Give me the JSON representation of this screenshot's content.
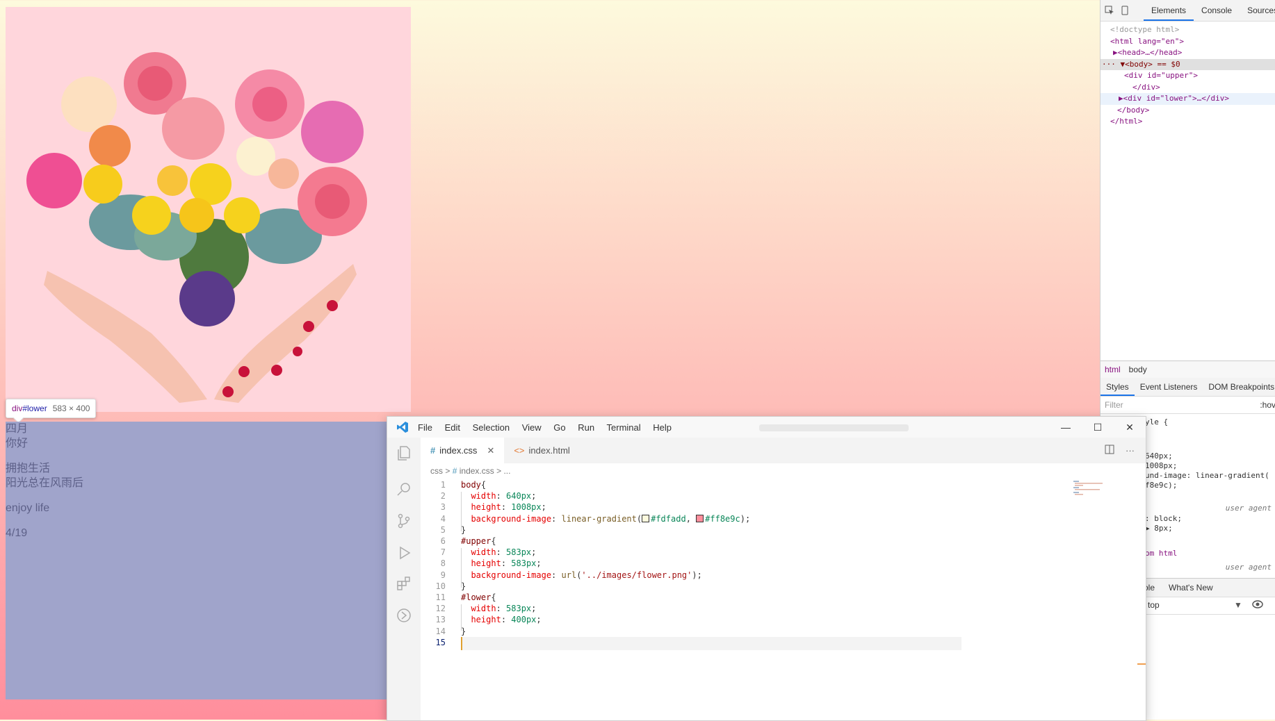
{
  "page": {
    "upper_id": "upper",
    "tooltip": {
      "tag": "div",
      "id": "#lower",
      "dims": "583 × 400"
    },
    "lower_lines": [
      "四月",
      "你好",
      "",
      "拥抱生活",
      "阳光总在风雨后",
      "",
      "enjoy life",
      "",
      "4/19"
    ]
  },
  "devtools": {
    "tabs": [
      "Elements",
      "Console",
      "Sources"
    ],
    "active_tab": "Elements",
    "dom": [
      {
        "text": "<!doctype html>",
        "kind": "comment",
        "indent": 0
      },
      {
        "text": "<html lang=\"en\">",
        "kind": "tag",
        "indent": 0
      },
      {
        "text": "▶<head>…</head>",
        "kind": "tag",
        "indent": 1
      },
      {
        "text": "··· ▼<body> == $0",
        "kind": "tag",
        "indent": 0,
        "selected": true
      },
      {
        "text": "<div id=\"upper\">",
        "kind": "tag",
        "indent": 2
      },
      {
        "text": "</div>",
        "kind": "tag",
        "indent": 3
      },
      {
        "text": "▶<div id=\"lower\">…</div>",
        "kind": "tag",
        "indent": 2,
        "hover": true
      },
      {
        "text": "</body>",
        "kind": "tag",
        "indent": 1
      },
      {
        "text": "</html>",
        "kind": "tag",
        "indent": 0
      }
    ],
    "crumbs": [
      "html",
      "body"
    ],
    "subtabs": [
      "Styles",
      "Event Listeners",
      "DOM Breakpoints"
    ],
    "filter_placeholder": "Filter",
    "hov_label": ":hov",
    "styles_lines": [
      "yle {",
      "640px;",
      "1008px;",
      "und-image: linear-gradient(",
      "f8e9c);",
      "user agent",
      ": block;",
      "▶ 8px;",
      "om html",
      "user agent"
    ],
    "drawer_tabs": [
      "ole",
      "What's New"
    ],
    "context": "top"
  },
  "vscode": {
    "menu": [
      "File",
      "Edit",
      "Selection",
      "View",
      "Go",
      "Run",
      "Terminal",
      "Help"
    ],
    "tabs": [
      {
        "label": "index.css",
        "active": true
      },
      {
        "label": "index.html",
        "active": false
      }
    ],
    "crumbs": [
      "css",
      ">",
      "#",
      "index.css",
      ">",
      "..."
    ],
    "code_lines": [
      "body{",
      "  width: 640px;",
      "  height: 1008px;",
      "  background-image: linear-gradient(#fdfadd, #ff8e9c);",
      "}",
      "#upper{",
      "  width: 583px;",
      "  height: 583px;",
      "  background-image: url('../images/flower.png');",
      "}",
      "#lower{",
      "  width: 583px;",
      "  height: 400px;",
      "}",
      ""
    ]
  },
  "colors": {
    "gradient_top": "#fdfadd",
    "gradient_bottom": "#ff8e9c",
    "lower_bg": "#a0a4cb",
    "upper_bg": "#ffd6dc"
  }
}
